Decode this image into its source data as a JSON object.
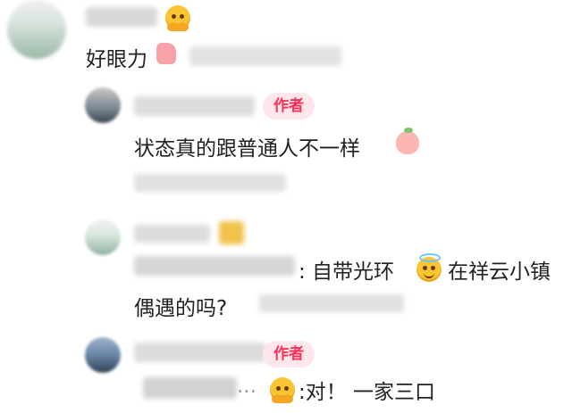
{
  "comments": [
    {
      "text": "好眼力",
      "emoji": "thumbs-up"
    },
    {
      "badge": "作者",
      "text": "状态真的跟普通人不一样",
      "emoji": "peach"
    },
    {
      "text": ": 自带光环",
      "emoji": "halo",
      "text2": "在祥云小镇",
      "line2": "偶遇的吗?"
    },
    {
      "badge": "作者",
      "ellipsis": "...",
      "text": ":对！ 一家三口",
      "emoji": "hands-smile"
    }
  ],
  "colors": {
    "badge_bg": "#fde7ea",
    "badge_text": "#ff2d55"
  }
}
